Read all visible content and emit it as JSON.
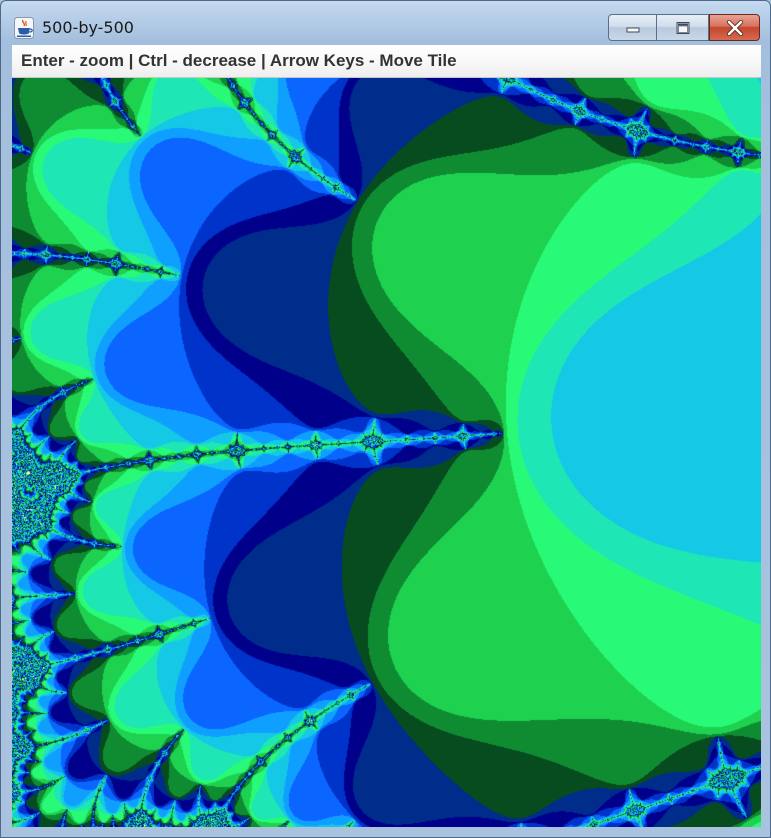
{
  "window": {
    "title": "500-by-500",
    "app_icon": "java-coffee-cup-icon"
  },
  "controls": {
    "minimize_icon": "minimize-icon",
    "maximize_icon": "maximize-icon",
    "close_icon": "close-icon"
  },
  "instructions": {
    "text": "Enter - zoom | Ctrl - decrease | Arrow Keys - Move Tile"
  },
  "fractal": {
    "kind": "mandelbrot",
    "interior_color": "#ffff99",
    "palette": [
      "#00008b",
      "#0033c9",
      "#0a66ff",
      "#0fa0ff",
      "#14c8e6",
      "#1ee6b4",
      "#28fa78",
      "#1ed250",
      "#0f8c32",
      "#064c1e",
      "#002c8c"
    ]
  }
}
